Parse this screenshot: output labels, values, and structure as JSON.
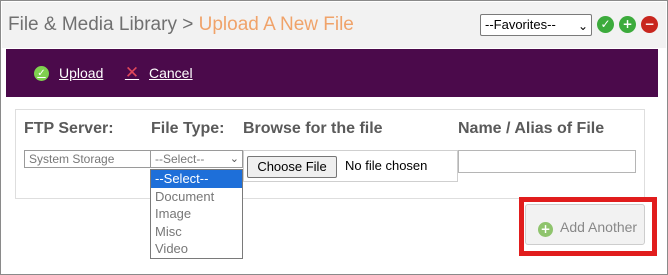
{
  "header": {
    "breadcrumb_root": "File & Media Library",
    "separator": ">",
    "current_page": "Upload A New File",
    "favorites_select": "--Favorites--",
    "icons": [
      "check-circle-icon",
      "plus-circle-icon",
      "minus-circle-icon"
    ]
  },
  "toolbar": {
    "upload_label": "Upload",
    "cancel_label": "Cancel",
    "background": "#4b0a4b"
  },
  "form": {
    "headers": {
      "ftp_server": "FTP Server:",
      "file_type": "File Type:",
      "browse": "Browse for the file",
      "name_alias": "Name / Alias of File"
    },
    "ftp_server_value": "System Storage",
    "file_type_value": "--Select--",
    "choose_file_label": "Choose File",
    "no_file_text": "No file chosen",
    "name_value": ""
  },
  "file_type_dropdown": {
    "options": [
      "--Select--",
      "Document",
      "Image",
      "Misc",
      "Video"
    ],
    "selected_index": 0
  },
  "add_another": {
    "label": "Add Another",
    "highlight_color": "#e11d1d"
  },
  "colors": {
    "accent_orange": "#f0a36a",
    "toolbar_purple": "#4b0a4b",
    "success_green": "#3cab3c",
    "danger_red": "#c8261e",
    "selection_blue": "#1e6fd9"
  }
}
